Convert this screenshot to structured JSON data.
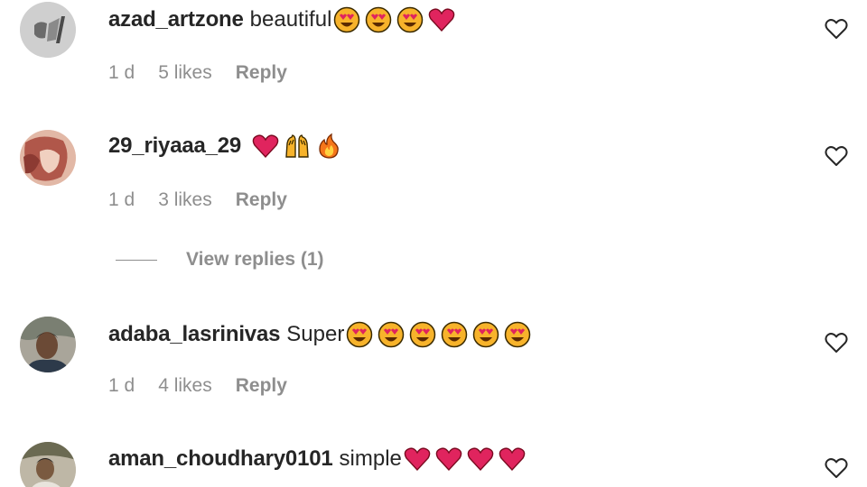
{
  "comments": [
    {
      "username": "azad_artzone",
      "text": "beautiful",
      "emojis": [
        "heart-eyes",
        "heart-eyes",
        "heart-eyes",
        "red-heart"
      ],
      "time": "1 d",
      "likes": "5 likes",
      "reply": "Reply"
    },
    {
      "username": "29_riyaaa_29",
      "text": "",
      "emojis": [
        "red-heart",
        "raising-hands",
        "fire"
      ],
      "time": "1 d",
      "likes": "3 likes",
      "reply": "Reply"
    },
    {
      "username": "adaba_lasrinivas",
      "text": "Super",
      "emojis": [
        "heart-eyes",
        "heart-eyes",
        "heart-eyes",
        "heart-eyes",
        "heart-eyes",
        "heart-eyes"
      ],
      "time": "1 d",
      "likes": "4 likes",
      "reply": "Reply"
    },
    {
      "username": "aman_choudhary0101",
      "text": "simple",
      "emojis": [
        "red-heart",
        "red-heart",
        "red-heart",
        "red-heart"
      ],
      "time": "",
      "likes": "",
      "reply": ""
    }
  ],
  "view_replies": "View replies (1)",
  "icons": {
    "like": "heart-outline-icon"
  },
  "colors": {
    "username": "#262626",
    "secondary": "#8e8e8e",
    "heart": "#e0245e",
    "emoji_face": "#f7b32b"
  }
}
